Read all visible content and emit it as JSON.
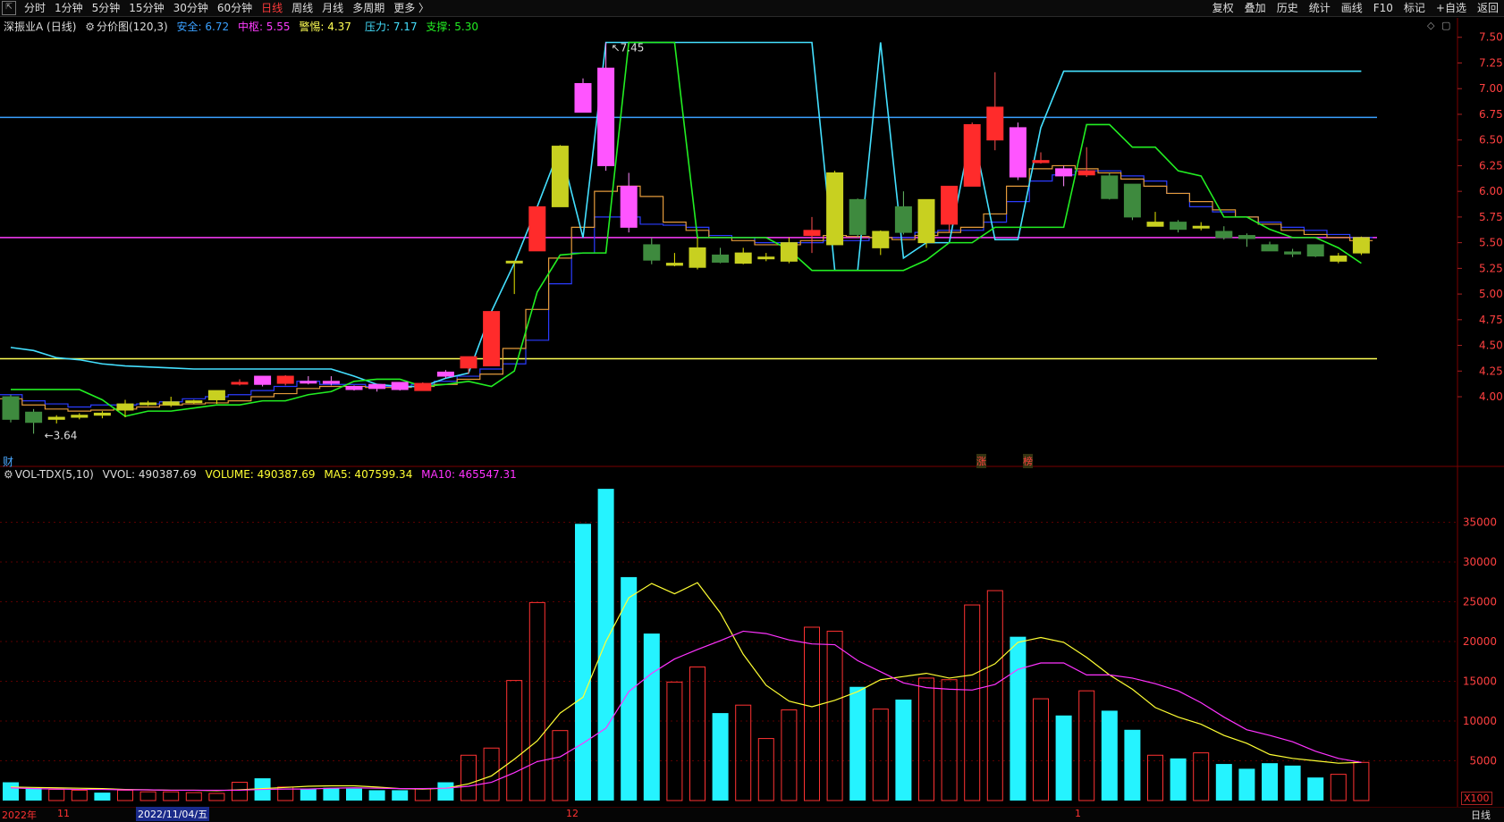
{
  "toolbar": {
    "left": [
      "分时",
      "1分钟",
      "5分钟",
      "15分钟",
      "30分钟",
      "60分钟",
      "日线",
      "周线",
      "月线",
      "多周期",
      "更多 〉"
    ],
    "active": "日线",
    "right": [
      "复权",
      "叠加",
      "历史",
      "统计",
      "画线",
      "F10",
      "标记",
      "+自选",
      "返回"
    ]
  },
  "main_legend": {
    "stock": "深振业A (日线)",
    "indicator": "分价图(120,3)",
    "safe": "安全: 6.72",
    "mid": "中枢: 5.55",
    "alert": "警惕: 4.37",
    "pressure": "压力: 7.17",
    "support": "支撑: 5.30"
  },
  "vol_legend": {
    "name": "VOL-TDX(5,10)",
    "vvol": "VVOL: 490387.69",
    "volume": "VOLUME: 490387.69",
    "ma5": "MA5: 407599.34",
    "ma10": "MA10: 465547.31"
  },
  "colors": {
    "up": "#ff3232",
    "down": "#54ffff",
    "safe": "#3aa0ff",
    "mid": "#ff3cff",
    "alert": "#ffff55",
    "pressure": "#44e0ff",
    "support": "#22ee22",
    "ma5": "#ffff33",
    "ma10": "#ff33ff"
  },
  "markers": {
    "high": "7.45",
    "low": "3.64",
    "cai": "财",
    "zhang": "涨",
    "bang": "榜"
  },
  "bottom": {
    "year": "2022年",
    "m11": "11",
    "date": "2022/11/04/五",
    "m12": "12",
    "m1": "1",
    "unit": "X100",
    "period": "日线"
  },
  "chart_data": {
    "type": "candlestick",
    "price_axis": {
      "min": 3.6,
      "max": 7.55,
      "ticks": [
        7.5,
        7.25,
        7.0,
        6.75,
        6.5,
        6.25,
        6.0,
        5.75,
        5.5,
        5.25,
        5.0,
        4.75,
        4.5,
        4.25,
        4.0
      ]
    },
    "volume_axis": {
      "min": 0,
      "max": 40000,
      "ticks": [
        35000,
        30000,
        25000,
        20000,
        15000,
        10000,
        5000
      ],
      "unit": "X100"
    },
    "horizontal_levels": {
      "safe": 6.72,
      "mid": 5.55,
      "alert": 4.37,
      "pressure": 7.17
    },
    "candles": [
      {
        "o": 4.0,
        "h": 4.02,
        "l": 3.75,
        "c": 3.78
      },
      {
        "o": 3.85,
        "h": 3.88,
        "l": 3.64,
        "c": 3.75
      },
      {
        "o": 3.78,
        "h": 3.82,
        "l": 3.74,
        "c": 3.8
      },
      {
        "o": 3.8,
        "h": 3.84,
        "l": 3.78,
        "c": 3.82
      },
      {
        "o": 3.82,
        "h": 3.86,
        "l": 3.79,
        "c": 3.84
      },
      {
        "o": 3.87,
        "h": 3.97,
        "l": 3.8,
        "c": 3.93
      },
      {
        "o": 3.93,
        "h": 3.96,
        "l": 3.91,
        "c": 3.94
      },
      {
        "o": 3.92,
        "h": 4.0,
        "l": 3.9,
        "c": 3.95
      },
      {
        "o": 3.95,
        "h": 3.97,
        "l": 3.93,
        "c": 3.96
      },
      {
        "o": 3.97,
        "h": 4.06,
        "l": 3.93,
        "c": 4.06
      },
      {
        "o": 4.13,
        "h": 4.17,
        "l": 4.11,
        "c": 4.14
      },
      {
        "o": 4.12,
        "h": 4.2,
        "l": 4.1,
        "c": 4.2
      },
      {
        "o": 4.2,
        "h": 4.21,
        "l": 4.11,
        "c": 4.13
      },
      {
        "o": 4.15,
        "h": 4.2,
        "l": 4.12,
        "c": 4.15
      },
      {
        "o": 4.15,
        "h": 4.2,
        "l": 4.11,
        "c": 4.13
      },
      {
        "o": 4.1,
        "h": 4.11,
        "l": 4.06,
        "c": 4.07
      },
      {
        "o": 4.12,
        "h": 4.12,
        "l": 4.05,
        "c": 4.08
      },
      {
        "o": 4.07,
        "h": 4.14,
        "l": 4.06,
        "c": 4.14
      },
      {
        "o": 4.06,
        "h": 4.14,
        "l": 4.06,
        "c": 4.13
      },
      {
        "o": 4.2,
        "h": 4.26,
        "l": 4.18,
        "c": 4.24
      },
      {
        "o": 4.28,
        "h": 4.36,
        "l": 4.22,
        "c": 4.39
      },
      {
        "o": 4.3,
        "h": 4.83,
        "l": 4.3,
        "c": 4.83
      },
      {
        "o": 5.32,
        "h": 5.32,
        "l": 5.0,
        "c": 5.31
      },
      {
        "o": 5.42,
        "h": 5.85,
        "l": 5.42,
        "c": 5.85
      },
      {
        "o": 5.85,
        "h": 6.45,
        "l": 5.85,
        "c": 6.44
      },
      {
        "o": 6.77,
        "h": 7.1,
        "l": 6.77,
        "c": 7.05
      },
      {
        "o": 6.25,
        "h": 7.45,
        "l": 6.2,
        "c": 7.2
      },
      {
        "o": 6.05,
        "h": 6.18,
        "l": 5.6,
        "c": 5.65
      },
      {
        "o": 5.48,
        "h": 5.55,
        "l": 5.29,
        "c": 5.33
      },
      {
        "o": 5.3,
        "h": 5.4,
        "l": 5.27,
        "c": 5.28
      },
      {
        "o": 5.45,
        "h": 5.55,
        "l": 5.24,
        "c": 5.26
      },
      {
        "o": 5.38,
        "h": 5.45,
        "l": 5.3,
        "c": 5.31
      },
      {
        "o": 5.4,
        "h": 5.45,
        "l": 5.29,
        "c": 5.3
      },
      {
        "o": 5.35,
        "h": 5.4,
        "l": 5.32,
        "c": 5.36
      },
      {
        "o": 5.5,
        "h": 5.55,
        "l": 5.3,
        "c": 5.32
      },
      {
        "o": 5.57,
        "h": 5.75,
        "l": 5.4,
        "c": 5.62
      },
      {
        "o": 5.48,
        "h": 6.2,
        "l": 5.48,
        "c": 6.18
      },
      {
        "o": 5.92,
        "h": 5.93,
        "l": 5.55,
        "c": 5.58
      },
      {
        "o": 5.45,
        "h": 5.62,
        "l": 5.38,
        "c": 5.61
      },
      {
        "o": 5.85,
        "h": 6.0,
        "l": 5.58,
        "c": 5.6
      },
      {
        "o": 5.5,
        "h": 5.92,
        "l": 5.45,
        "c": 5.92
      },
      {
        "o": 5.68,
        "h": 6.05,
        "l": 5.6,
        "c": 6.05
      },
      {
        "o": 6.05,
        "h": 6.67,
        "l": 6.05,
        "c": 6.65
      },
      {
        "o": 6.5,
        "h": 7.16,
        "l": 6.4,
        "c": 6.82
      },
      {
        "o": 6.14,
        "h": 6.67,
        "l": 6.11,
        "c": 6.62
      },
      {
        "o": 6.28,
        "h": 6.38,
        "l": 6.27,
        "c": 6.3
      },
      {
        "o": 6.22,
        "h": 6.25,
        "l": 6.05,
        "c": 6.15
      },
      {
        "o": 6.16,
        "h": 6.43,
        "l": 6.14,
        "c": 6.2
      },
      {
        "o": 6.15,
        "h": 6.18,
        "l": 5.92,
        "c": 5.93
      },
      {
        "o": 6.07,
        "h": 6.07,
        "l": 5.72,
        "c": 5.75
      },
      {
        "o": 5.7,
        "h": 5.8,
        "l": 5.66,
        "c": 5.66
      },
      {
        "o": 5.7,
        "h": 5.72,
        "l": 5.6,
        "c": 5.63
      },
      {
        "o": 5.66,
        "h": 5.7,
        "l": 5.62,
        "c": 5.66
      },
      {
        "o": 5.61,
        "h": 5.66,
        "l": 5.53,
        "c": 5.55
      },
      {
        "o": 5.57,
        "h": 5.59,
        "l": 5.46,
        "c": 5.54
      },
      {
        "o": 5.48,
        "h": 5.51,
        "l": 5.42,
        "c": 5.42
      },
      {
        "o": 5.41,
        "h": 5.44,
        "l": 5.36,
        "c": 5.39
      },
      {
        "o": 5.48,
        "h": 5.48,
        "l": 5.36,
        "c": 5.37
      },
      {
        "o": 5.37,
        "h": 5.4,
        "l": 5.3,
        "c": 5.32
      },
      {
        "o": 5.4,
        "h": 5.56,
        "l": 5.38,
        "c": 5.55
      }
    ],
    "candle_colors": [
      "down",
      "down",
      "yellow",
      "yellow",
      "yellow",
      "yellow",
      "yellow",
      "yellow",
      "yellow",
      "yellow",
      "up",
      "pink",
      "up",
      "pink",
      "pink",
      "pink",
      "pink",
      "pink",
      "up",
      "pink",
      "up",
      "up",
      "yellow",
      "up",
      "yellow",
      "pink",
      "pink",
      "pink",
      "down",
      "yellow",
      "yellow",
      "down",
      "yellow",
      "yellow",
      "yellow",
      "up",
      "yellow",
      "down",
      "yellow",
      "down",
      "yellow",
      "up",
      "up",
      "up",
      "pink",
      "up",
      "pink",
      "up",
      "down",
      "down",
      "yellow",
      "down",
      "yellow",
      "down",
      "down",
      "down",
      "down",
      "down",
      "yellow",
      "yellow"
    ],
    "volumes": [
      2300,
      1600,
      1400,
      1300,
      1000,
      1300,
      1100,
      1100,
      1000,
      900,
      2300,
      2800,
      1700,
      1500,
      1600,
      1500,
      1300,
      1300,
      1500,
      2300,
      5700,
      6600,
      15100,
      24900,
      8800,
      34800,
      39200,
      28100,
      21000,
      14900,
      16800,
      11000,
      12000,
      7800,
      11400,
      21800,
      21300,
      14300,
      11500,
      12700,
      15400,
      15200,
      24600,
      26400,
      20600,
      12800,
      10700,
      13800,
      11300,
      8900,
      5700,
      5300,
      6000,
      4600,
      4000,
      4700,
      4400,
      2900,
      3300,
      4800
    ],
    "volume_colors": [
      "down",
      "down",
      "up",
      "up",
      "down",
      "up",
      "up",
      "up",
      "up",
      "up",
      "up",
      "down",
      "up",
      "down",
      "down",
      "down",
      "down",
      "down",
      "up",
      "down",
      "up",
      "up",
      "up",
      "up",
      "up",
      "down",
      "down",
      "down",
      "down",
      "up",
      "up",
      "down",
      "up",
      "up",
      "up",
      "up",
      "up",
      "down",
      "up",
      "down",
      "up",
      "up",
      "up",
      "up",
      "down",
      "up",
      "down",
      "up",
      "down",
      "down",
      "up",
      "down",
      "up",
      "down",
      "down",
      "down",
      "down",
      "down",
      "up",
      "up"
    ],
    "ma5": [
      1700,
      1650,
      1600,
      1550,
      1500,
      1400,
      1350,
      1300,
      1300,
      1250,
      1350,
      1500,
      1650,
      1800,
      1850,
      1850,
      1700,
      1500,
      1450,
      1550,
      2100,
      3100,
      5200,
      7500,
      11000,
      13000,
      20000,
      25500,
      27300,
      26000,
      27400,
      23600,
      18400,
      14500,
      12500,
      11800,
      12600,
      13700,
      15200,
      15600,
      16000,
      15400,
      15800,
      17200,
      19900,
      20500,
      19900,
      18000,
      15800,
      14000,
      11700,
      10500,
      9600,
      8200,
      7200,
      5800,
      5300,
      5000,
      4700,
      4800
    ],
    "ma10": [
      1600,
      1500,
      1450,
      1400,
      1400,
      1350,
      1350,
      1300,
      1300,
      1300,
      1300,
      1400,
      1450,
      1450,
      1550,
      1600,
      1550,
      1500,
      1500,
      1550,
      1800,
      2300,
      3500,
      4900,
      5500,
      7200,
      9100,
      13700,
      16000,
      17800,
      19000,
      20100,
      21300,
      21000,
      20200,
      19700,
      19600,
      17600,
      16200,
      14800,
      14200,
      14000,
      13900,
      14600,
      16500,
      17300,
      17300,
      15800,
      15800,
      15400,
      14700,
      13800,
      12300,
      10500,
      8900,
      8200,
      7400,
      6200,
      5300,
      4800
    ],
    "pressure_line": [
      4.48,
      4.45,
      4.38,
      4.36,
      4.32,
      4.3,
      4.29,
      4.28,
      4.27,
      4.27,
      4.27,
      4.27,
      4.27,
      4.27,
      4.27,
      4.2,
      4.12,
      4.1,
      4.1,
      4.18,
      4.23,
      4.83,
      5.3,
      5.85,
      6.43,
      5.55,
      7.45,
      7.45,
      7.45,
      7.45,
      7.45,
      7.45,
      7.45,
      7.45,
      7.45,
      7.45,
      5.23,
      5.23,
      7.45,
      5.35,
      5.5,
      5.5,
      6.62,
      5.53,
      5.53,
      6.62,
      7.17,
      7.17,
      7.17,
      7.17,
      7.17,
      7.17,
      7.17,
      7.17,
      7.17,
      7.17,
      7.17,
      7.17,
      7.17,
      7.17
    ],
    "support_line": [
      4.07,
      4.07,
      4.07,
      4.07,
      3.97,
      3.81,
      3.86,
      3.86,
      3.89,
      3.92,
      3.92,
      3.96,
      3.96,
      4.02,
      4.05,
      4.15,
      4.17,
      4.17,
      4.1,
      4.12,
      4.15,
      4.1,
      4.25,
      5.02,
      5.38,
      5.4,
      5.4,
      7.45,
      7.45,
      7.45,
      5.55,
      5.55,
      5.55,
      5.55,
      5.43,
      5.23,
      5.23,
      5.23,
      5.23,
      5.23,
      5.33,
      5.5,
      5.5,
      5.65,
      5.65,
      5.65,
      5.65,
      6.65,
      6.65,
      6.43,
      6.43,
      6.2,
      6.15,
      5.75,
      5.75,
      5.63,
      5.55,
      5.55,
      5.45,
      5.3
    ],
    "safe_step": [
      4.02,
      3.96,
      3.93,
      3.9,
      3.92,
      3.92,
      3.93,
      3.95,
      3.98,
      4.0,
      4.02,
      4.06,
      4.1,
      4.15,
      4.12,
      4.12,
      4.1,
      4.1,
      4.12,
      4.15,
      4.2,
      4.27,
      4.32,
      4.55,
      5.1,
      5.4,
      5.75,
      5.75,
      5.68,
      5.67,
      5.65,
      5.57,
      5.55,
      5.5,
      5.5,
      5.5,
      5.52,
      5.52,
      5.55,
      5.55,
      5.6,
      5.62,
      5.62,
      5.7,
      5.9,
      6.1,
      6.16,
      6.2,
      6.2,
      6.15,
      6.1,
      5.98,
      5.85,
      5.8,
      5.75,
      5.7,
      5.65,
      5.62,
      5.58,
      5.55
    ],
    "avg_step": [
      3.98,
      3.92,
      3.88,
      3.86,
      3.87,
      3.88,
      3.9,
      3.92,
      3.93,
      3.94,
      3.96,
      4.0,
      4.03,
      4.08,
      4.1,
      4.1,
      4.09,
      4.09,
      4.1,
      4.12,
      4.17,
      4.22,
      4.47,
      4.85,
      5.35,
      5.65,
      6.0,
      6.05,
      5.95,
      5.7,
      5.62,
      5.55,
      5.52,
      5.48,
      5.48,
      5.52,
      5.57,
      5.56,
      5.55,
      5.53,
      5.57,
      5.6,
      5.65,
      5.78,
      6.05,
      6.22,
      6.25,
      6.22,
      6.18,
      6.12,
      6.05,
      5.98,
      5.9,
      5.82,
      5.75,
      5.68,
      5.62,
      5.58,
      5.55,
      5.52
    ]
  }
}
